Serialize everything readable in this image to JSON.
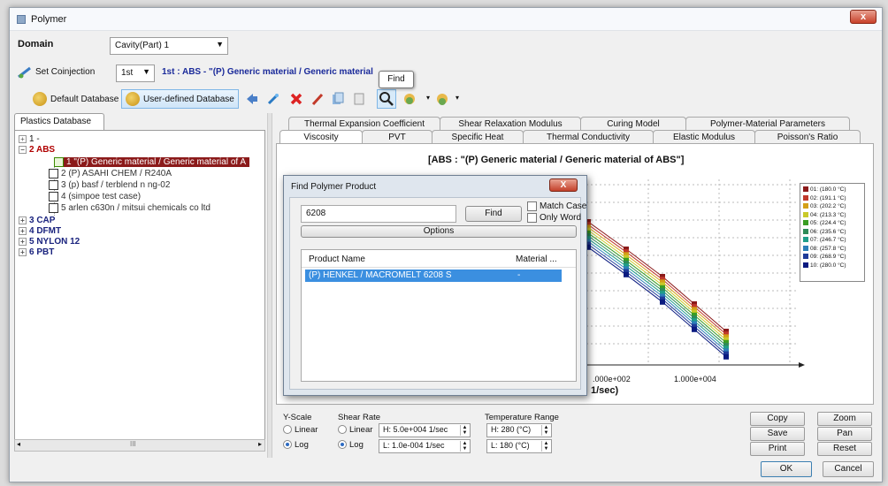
{
  "window": {
    "title": "Polymer",
    "close_glyph": "x"
  },
  "domain": {
    "label": "Domain",
    "value": "Cavity(Part) 1"
  },
  "coinjection": {
    "label": "Set Coinjection",
    "value": "1st",
    "material_text": "1st : ABS - \"(P)  Generic material / Generic material"
  },
  "toolbar": {
    "default_db_label": "Default Database",
    "user_db_label": "User-defined Database",
    "find_tooltip": "Find"
  },
  "tree": {
    "tab_label": "Plastics Database",
    "categories": [
      {
        "label": "1  -",
        "expanded": false
      },
      {
        "label": "2  ABS",
        "expanded": true
      },
      {
        "label": "3  CAP",
        "expanded": false
      },
      {
        "label": "4  DFMT",
        "expanded": false
      },
      {
        "label": "5  NYLON 12",
        "expanded": false
      },
      {
        "label": "6  PBT",
        "expanded": false
      }
    ],
    "abs_items": [
      "1  \"(P)  Generic material / Generic material of A",
      "2  (P)  ASAHI CHEM / R240A",
      "3  (p)  basf / terblend n ng-02",
      "4  (simpoe test case)",
      "5  arlen c630n / mitsui chemicals co ltd"
    ],
    "scroll_glyph": "III"
  },
  "tabs_top": [
    "Thermal Expansion Coefficient",
    "Shear Relaxation Modulus",
    "Curing Model",
    "Polymer-Material Parameters"
  ],
  "tabs_bottom": [
    "Viscosity",
    "PVT",
    "Specific Heat",
    "Thermal Conductivity",
    "Elastic Modulus",
    "Poisson's Ratio"
  ],
  "chart": {
    "title": "[ABS : \"(P)  Generic material / Generic material of ABS\"]",
    "xlabel": "1/sec)",
    "xticks": [
      ".000e+002",
      "1.000e+004"
    ],
    "legend": [
      {
        "label": "01: (180.0 °C)",
        "color": "#8b1a1a"
      },
      {
        "label": "02: (191.1 °C)",
        "color": "#c0392b"
      },
      {
        "label": "03: (202.2 °C)",
        "color": "#d4a017"
      },
      {
        "label": "04: (213.3 °C)",
        "color": "#c9c92a"
      },
      {
        "label": "05: (224.4 °C)",
        "color": "#3a9d23"
      },
      {
        "label": "06: (235.6 °C)",
        "color": "#2e8b57"
      },
      {
        "label": "07: (246.7 °C)",
        "color": "#1f9e89"
      },
      {
        "label": "08: (257.8 °C)",
        "color": "#2c7fb8"
      },
      {
        "label": "09: (268.9 °C)",
        "color": "#1f3b99"
      },
      {
        "label": "10: (280.0 °C)",
        "color": "#0a1a80"
      }
    ]
  },
  "find_dialog": {
    "title": "Find Polymer Product",
    "close_glyph": "X",
    "search_value": "6208",
    "find_label": "Find",
    "match_case_label": "Match Case",
    "only_word_label": "Only Word",
    "options_label": "Options",
    "col_product": "Product Name",
    "col_material": "Material ...",
    "results": [
      {
        "product": "(P)  HENKEL / MACROMELT 6208 S",
        "material": "-"
      }
    ]
  },
  "bottom": {
    "yscale_label": "Y-Scale",
    "yscale_options": [
      "Linear",
      "Log"
    ],
    "yscale_selected": "Log",
    "shear_label": "Shear Rate",
    "shear_options": [
      "Linear",
      "Log"
    ],
    "shear_selected": "Log",
    "shear_high": "H: 5.0e+004 1/sec",
    "shear_low": "L: 1.0e-004 1/sec",
    "temp_label": "Temperature Range",
    "temp_high": "H: 280 (°C)",
    "temp_low": "L: 180 (°C)",
    "buttons": [
      "Copy",
      "Zoom",
      "Save",
      "Pan",
      "Print",
      "Reset"
    ],
    "ok_label": "OK",
    "cancel_label": "Cancel"
  }
}
